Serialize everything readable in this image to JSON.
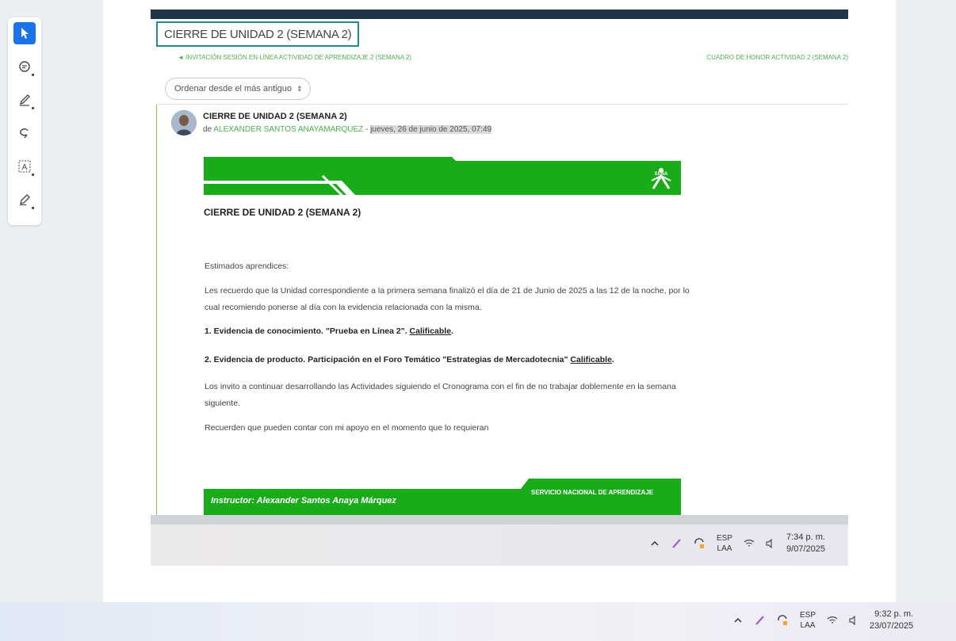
{
  "toolbar": {
    "tools": [
      {
        "name": "select-tool",
        "icon": "cursor-icon",
        "active": true
      },
      {
        "name": "comment-tool",
        "icon": "comment-icon"
      },
      {
        "name": "highlight-tool",
        "icon": "pen-icon"
      },
      {
        "name": "lasso-tool",
        "icon": "lasso-icon"
      },
      {
        "name": "text-tool",
        "icon": "text-box-icon"
      },
      {
        "name": "draw-tool",
        "icon": "signature-icon"
      }
    ],
    "accent": "#1a73e8"
  },
  "discussion": {
    "title": "CIERRE DE UNIDAD 2 (SEMANA 2)",
    "prev_link": "◄ INVITACIÓN SESIÓN EN LÍNEA ACTIVIDAD DE APRENDIZAJE 2 (SEMANA 2)",
    "next_link": "CUADRO DE HONOR ACTIVIDAD 2 (SEMANA 2)",
    "sort_value": "Ordenar desde el más antiguo"
  },
  "post": {
    "title": "CIERRE DE UNIDAD 2 (SEMANA 2)",
    "by": "de ",
    "author": "ALEXANDER SANTOS ANAYAMARQUEZ",
    "dash": " - ",
    "date": "jueves, 26 de junio de 2025, 07:49",
    "banner_logo": "SENA",
    "banner_title": "CIERRE DE UNIDAD 2 (SEMANA 2)",
    "greeting": "Estimados aprendices:",
    "paragraph1": "Les recuerdo que la Unidad correspondiente a la primera semana finalizó el día de 21 de Junio de 2025 a las 12 de la noche, por lo cual recomiendo ponerse al día con la evidencia relacionada con la misma.",
    "item1_text": "1. Evidencia de conocimiento. \"Prueba en Línea 2\". ",
    "item1_link": "Calificable",
    "item1_end": ".",
    "item2_text": "2. Evidencia de producto. Participación en el Foro Temático \"Estrategias de Mercadotecnia\" ",
    "item2_link": "Calificable",
    "item2_end": ".",
    "paragraph2": "Los invito a continuar desarrollando las Actividades siguiendo el Cronograma con el fin de no trabajar doblemente en la semana siguiente.",
    "paragraph3": "Recuerden que pueden contar con mi apoyo en el momento que lo requieran",
    "footer_instructor": "Instructor: Alexander Santos Anaya Márquez",
    "footer_org": "SERVICIO NACIONAL DE APRENDIZAJE",
    "brand_green": "#1aab1a"
  },
  "inner_tray": {
    "lang_top": "ESP",
    "lang_bottom": "LAA",
    "time": "7:34 p. m.",
    "date": "9/07/2025"
  },
  "outer_tray": {
    "lang_top": "ESP",
    "lang_bottom": "LAA",
    "time": "9:32 p. m.",
    "date": "23/07/2025"
  }
}
